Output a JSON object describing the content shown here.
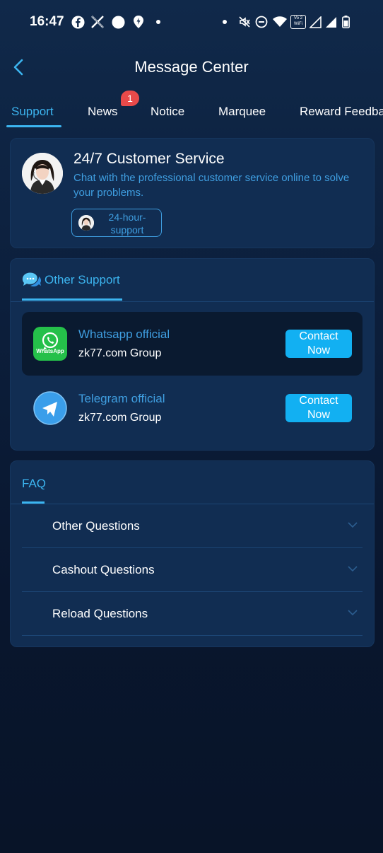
{
  "status_bar": {
    "time": "16:47",
    "left_icons": [
      "facebook-icon",
      "x-icon",
      "circle-icon",
      "location-icon",
      "dot-icon"
    ],
    "right_icons": [
      "dot-icon",
      "mute-icon",
      "dnd-icon",
      "wifi-icon",
      "vowifi-icon",
      "signal-icon",
      "signal-icon",
      "battery-icon"
    ],
    "vowifi_label": "Vo WiFi 2"
  },
  "header": {
    "title": "Message Center",
    "back_icon": "chevron-left-icon"
  },
  "tabs": [
    {
      "label": "Support",
      "active": true
    },
    {
      "label": "News",
      "badge": "1"
    },
    {
      "label": "Notice"
    },
    {
      "label": "Marquee"
    },
    {
      "label": "Reward Feedba"
    }
  ],
  "customer_service": {
    "title": "24/7 Customer Service",
    "description": "Chat with the professional customer service online to solve your problems.",
    "pill_label": "24-hour-support"
  },
  "other_support": {
    "title": "Other Support",
    "contacts": [
      {
        "name": "Whatsapp official",
        "group": "zk77.com Group",
        "button": "Contact Now",
        "icon": "whatsapp-icon",
        "icon_text": "WhatsApp"
      },
      {
        "name": "Telegram official",
        "group": "zk77.com Group",
        "button": "Contact Now",
        "icon": "telegram-icon"
      }
    ]
  },
  "faq": {
    "title": "FAQ",
    "items": [
      {
        "label": "Other Questions"
      },
      {
        "label": "Cashout Questions"
      },
      {
        "label": "Reload Questions"
      }
    ]
  },
  "colors": {
    "accent": "#3cb5f0",
    "button": "#12b0f2",
    "card": "#112d52",
    "badge": "#e84a4a",
    "whatsapp": "#25c04a",
    "telegram": "#3a9eea"
  }
}
